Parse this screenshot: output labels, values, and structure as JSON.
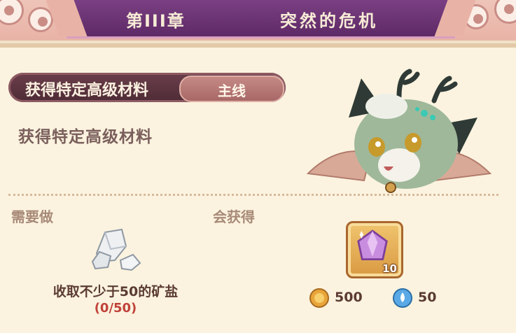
{
  "header": {
    "chapter": "第III章",
    "title": "突然的危机"
  },
  "task": {
    "title": "获得特定高级材料",
    "tag": "主线",
    "description": "获得特定高级材料"
  },
  "requirement": {
    "section_label": "需要做",
    "item_icon": "mineral-salt-icon",
    "text": "收取不少于50的矿盐",
    "progress": "(0/50)"
  },
  "reward": {
    "section_label": "会获得",
    "item_icon": "purple-gem-icon",
    "item_count": "10",
    "currencies": [
      {
        "icon": "gold-coin-icon",
        "value": "500"
      },
      {
        "icon": "blue-drop-icon",
        "value": "50"
      }
    ]
  },
  "colors": {
    "header_purple": "#6b3474",
    "panel_bg": "#fbf3df",
    "tag_pink": "#b97876",
    "progress_red": "#c0423a"
  }
}
